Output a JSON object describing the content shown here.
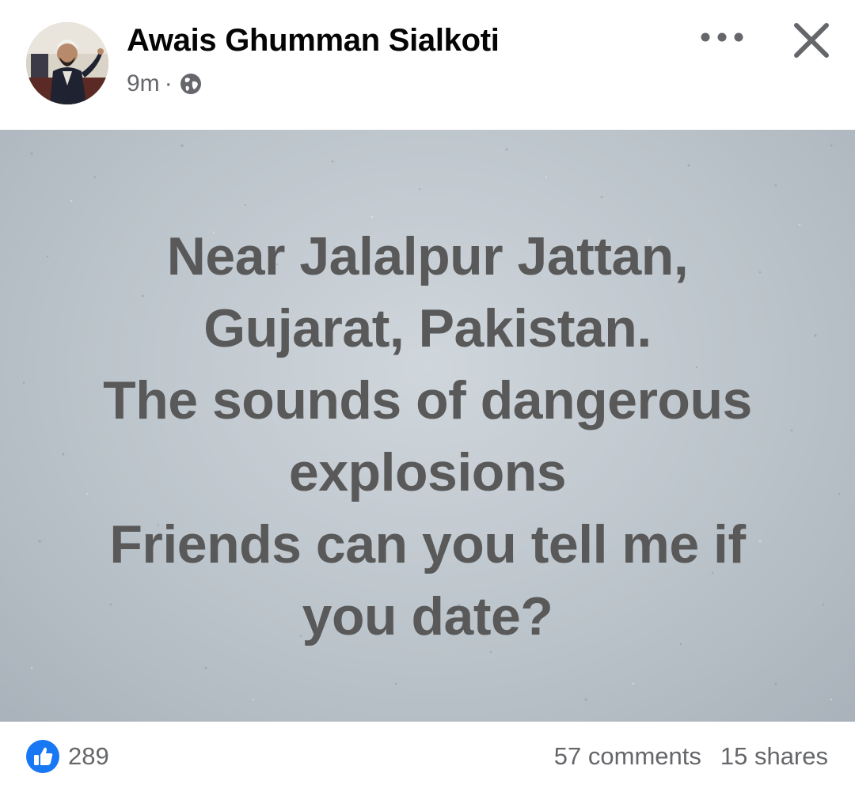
{
  "post": {
    "author_name": "Awais Ghumman Sialkoti",
    "time": "9m",
    "separator": "·",
    "audience_icon": "globe-icon",
    "avatar_icon": "profile-photo",
    "lines": [
      "Near Jalalpur Jattan,",
      "Gujarat, Pakistan.",
      "The sounds of dangerous",
      "explosions",
      "Friends can you tell me if",
      "you date?"
    ],
    "background_color": "#bcc4cb",
    "text_color": "#595959"
  },
  "actions": {
    "more_icon": "more-horizontal-icon",
    "close_icon": "close-icon"
  },
  "footer": {
    "like_icon": "like-icon",
    "like_color": "#1877f2",
    "likes": "289",
    "comments": "57 comments",
    "shares": "15 shares"
  }
}
